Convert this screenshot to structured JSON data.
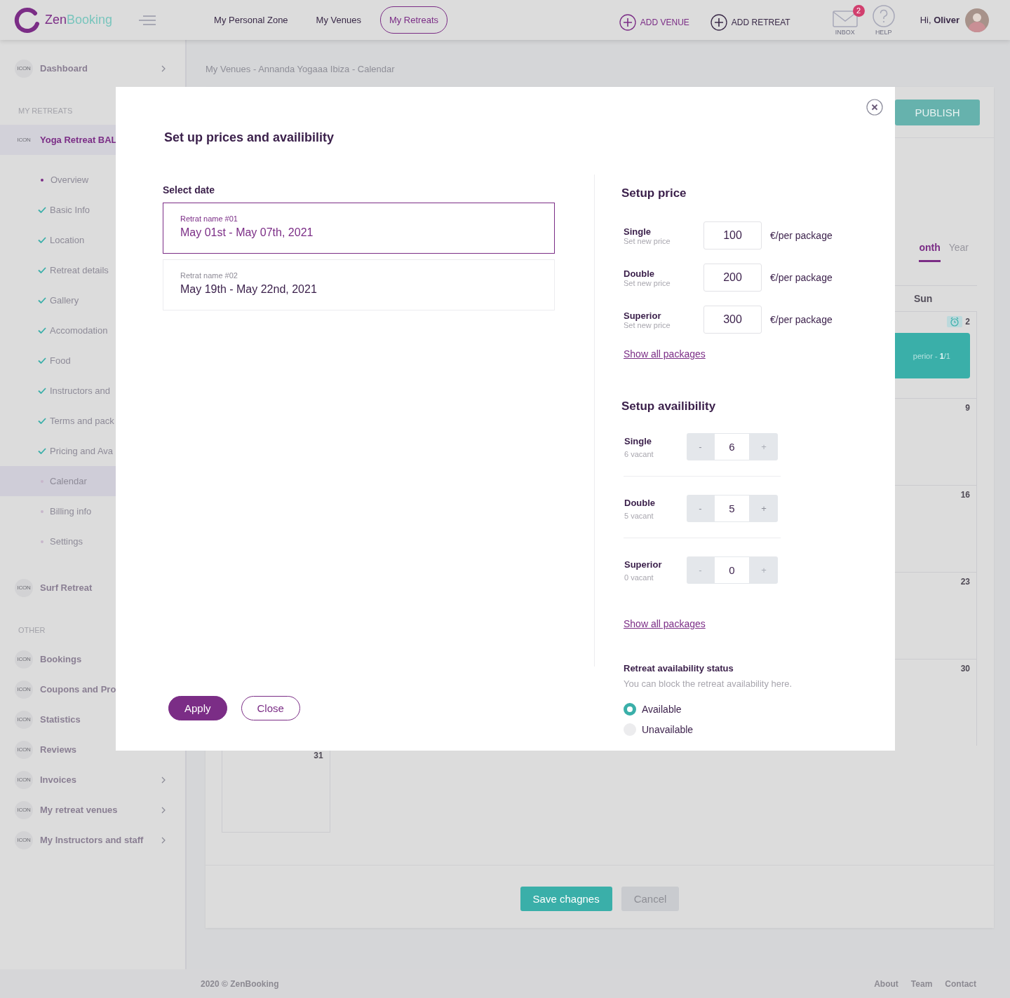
{
  "header": {
    "logo": {
      "first": "Zen",
      "second": "Booking"
    },
    "nav": [
      {
        "label": "My Personal Zone",
        "selected": false
      },
      {
        "label": "My Venues",
        "selected": false
      },
      {
        "label": "My Retreats",
        "selected": true
      }
    ],
    "actions": [
      {
        "label": "ADD VENUE",
        "highlighted": true
      },
      {
        "label": "ADD RETREAT",
        "highlighted": false
      }
    ],
    "inbox": {
      "label": "INBOX",
      "badge": "2"
    },
    "help": {
      "label": "HELP"
    },
    "greeting": {
      "prefix": "Hi,",
      "name": "Oliver"
    }
  },
  "sidebar": {
    "sections": [
      {
        "items": [
          {
            "label": "Dashboard",
            "icon_text": "ICON",
            "chevron": true,
            "selected": false
          }
        ]
      },
      {
        "title": "MY RETREATS",
        "items": [
          {
            "label": "Yoga Retreat BAL",
            "icon_text": "ICON",
            "chevron": false,
            "selected": true,
            "children": [
              {
                "label": "Overview",
                "done": false,
                "current": true,
                "selected": false
              },
              {
                "label": "Basic Info",
                "done": true,
                "current": false,
                "selected": false
              },
              {
                "label": "Location",
                "done": true,
                "current": false,
                "selected": false
              },
              {
                "label": "Retreat details",
                "done": true,
                "current": false,
                "selected": false
              },
              {
                "label": "Gallery",
                "done": true,
                "current": false,
                "selected": false
              },
              {
                "label": "Accomodation",
                "done": true,
                "current": false,
                "selected": false
              },
              {
                "label": "Food",
                "done": true,
                "current": false,
                "selected": false
              },
              {
                "label": "Instructors and",
                "done": true,
                "current": false,
                "selected": false
              },
              {
                "label": "Terms and pack",
                "done": true,
                "current": false,
                "selected": false
              },
              {
                "label": "Pricing and Ava",
                "done": true,
                "current": false,
                "selected": false
              },
              {
                "label": "Calendar",
                "done": false,
                "current": false,
                "selected": true
              },
              {
                "label": "Billing info",
                "done": false,
                "current": false,
                "selected": false
              },
              {
                "label": "Settings",
                "done": false,
                "current": false,
                "selected": false
              }
            ]
          },
          {
            "label": "Surf Retreat",
            "icon_text": "ICON",
            "chevron": false,
            "selected": false
          }
        ]
      },
      {
        "title": "OTHER",
        "items": [
          {
            "label": "Bookings",
            "icon_text": "ICON",
            "chevron": false,
            "selected": false
          },
          {
            "label": "Coupons and Pro",
            "icon_text": "ICON",
            "chevron": false,
            "selected": false
          },
          {
            "label": "Statistics",
            "icon_text": "ICON",
            "chevron": false,
            "selected": false
          },
          {
            "label": "Reviews",
            "icon_text": "ICON",
            "chevron": false,
            "selected": false
          },
          {
            "label": "Invoices",
            "icon_text": "ICON",
            "chevron": true,
            "selected": false
          },
          {
            "label": "My retreat venues",
            "icon_text": "ICON",
            "chevron": true,
            "selected": false
          },
          {
            "label": "My Instructors and staff",
            "icon_text": "ICON",
            "chevron": true,
            "selected": false
          }
        ]
      }
    ]
  },
  "breadcrumb": "My Venues - Annanda Yogaaa Ibiza - Calendar",
  "calendar_card": {
    "publish": "PUBLISH",
    "views": [
      {
        "label": "onth",
        "selected": true
      },
      {
        "label": "Year",
        "selected": false
      }
    ],
    "weekday": "Sun",
    "weeks": [
      {
        "day": "2",
        "reminder": true,
        "event": "perior - **1**/1"
      },
      {
        "day": "9",
        "reminder": false
      },
      {
        "day": "16",
        "reminder": false
      },
      {
        "day": "23",
        "reminder": false
      },
      {
        "day": "30",
        "reminder": false
      }
    ],
    "overflow_day": "31",
    "buttons": [
      {
        "label": "Save chagnes",
        "kind": "primary"
      },
      {
        "label": "Cancel",
        "kind": "secondary"
      }
    ]
  },
  "footer": {
    "copyright": "2020 © ZenBooking",
    "links": [
      "About",
      "Team",
      "Contact"
    ]
  },
  "modal": {
    "title": "Set up prices and availibility",
    "select_date": {
      "title": "Select date",
      "dates": [
        {
          "name": "Retrat name #01",
          "range": "May 01st - May 07th, 2021",
          "selected": true
        },
        {
          "name": "Retrat name #02",
          "range": "May 19th - May 22nd, 2021",
          "selected": false
        }
      ]
    },
    "buttons": [
      {
        "label": "Apply",
        "kind": "primary"
      },
      {
        "label": "Close",
        "kind": "outline"
      }
    ],
    "price": {
      "title": "Setup price",
      "rows": [
        {
          "name": "Single",
          "hint": "Set new price",
          "value": "100",
          "unit": "€/per package"
        },
        {
          "name": "Double",
          "hint": "Set new price",
          "value": "200",
          "unit": "€/per package"
        },
        {
          "name": "Superior",
          "hint": "Set new price",
          "value": "300",
          "unit": "€/per package"
        }
      ],
      "link": "Show all packages"
    },
    "availability": {
      "title": "Setup availibility",
      "rows": [
        {
          "name": "Single",
          "vacant": "6 vacant",
          "value": "6",
          "minus": "-",
          "plus": "+",
          "minus_disabled": false,
          "plus_disabled": true
        },
        {
          "name": "Double",
          "vacant": "5 vacant",
          "value": "5",
          "minus": "-",
          "plus": "+",
          "minus_disabled": false,
          "plus_disabled": false
        },
        {
          "name": "Superior",
          "vacant": "0 vacant",
          "value": "0",
          "minus": "-",
          "plus": "+",
          "minus_disabled": true,
          "plus_disabled": true
        }
      ],
      "link": "Show all packages"
    },
    "status": {
      "title": "Retreat availability status",
      "hint": "You can block the retreat availability here.",
      "options": [
        {
          "label": "Available",
          "selected": true
        },
        {
          "label": "Unavailable",
          "selected": false
        }
      ]
    }
  }
}
